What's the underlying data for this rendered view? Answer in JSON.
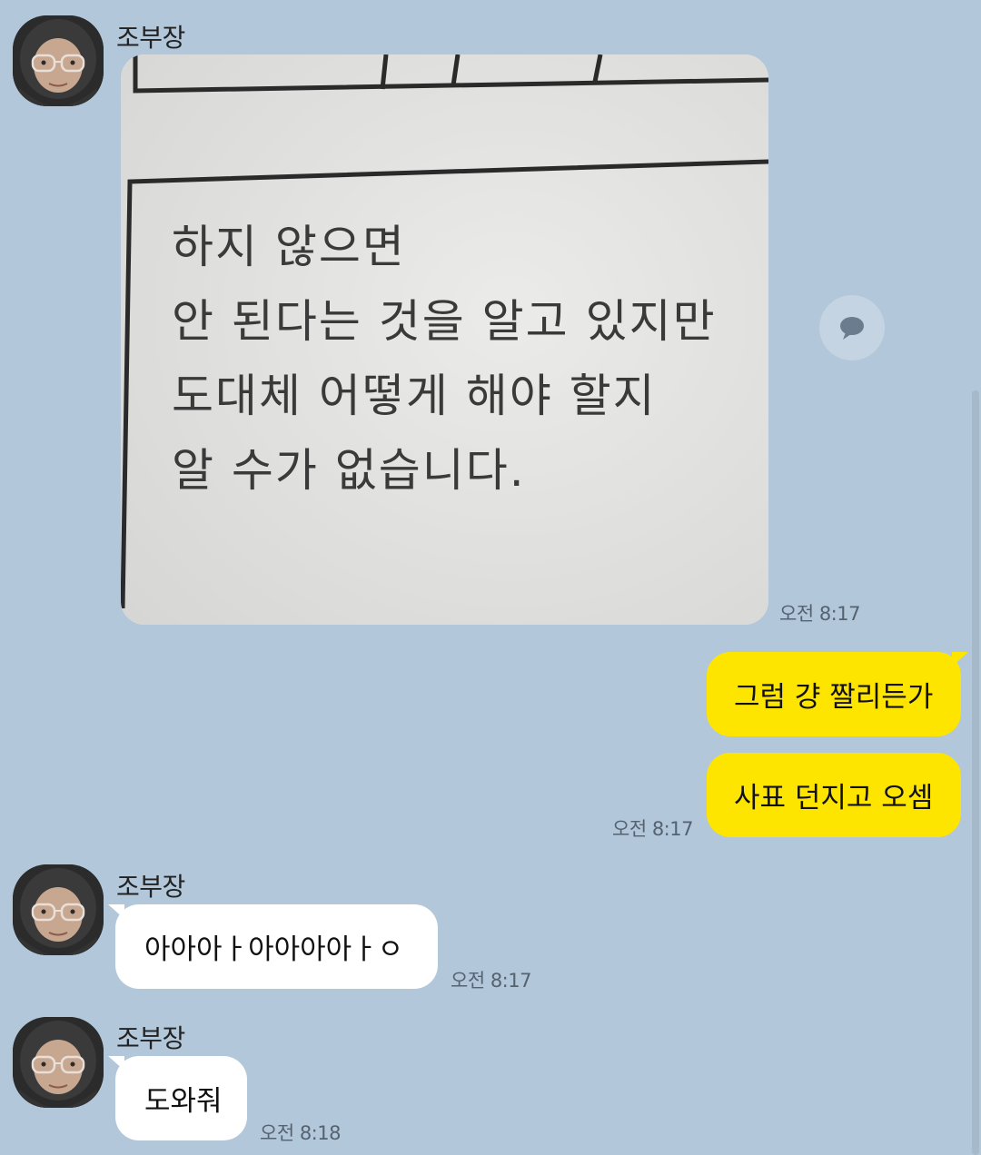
{
  "messages": [
    {
      "sender": "조부장",
      "type": "image",
      "time": "오전 8:17",
      "image_text": [
        "하지 않으면",
        "안 된다는 것을 알고 있지만",
        "도대체 어떻게 해야 할지",
        "알 수가 없습니다."
      ]
    },
    {
      "sender": "me",
      "text": "그럼 걍 짤리든가"
    },
    {
      "sender": "me",
      "text": "사표 던지고 오셈",
      "time": "오전 8:17"
    },
    {
      "sender": "조부장",
      "text": "아아아ㅏ아아아아ㅏㅇ",
      "time": "오전 8:17"
    },
    {
      "sender": "조부장",
      "text": "도와줘",
      "time": "오전 8:18"
    }
  ],
  "icons": {
    "share": "share-speech-bubble-icon",
    "avatar": "profile-photo"
  },
  "colors": {
    "background": "#b2c7da",
    "outgoing_bubble": "#fee500",
    "incoming_bubble": "#ffffff"
  }
}
